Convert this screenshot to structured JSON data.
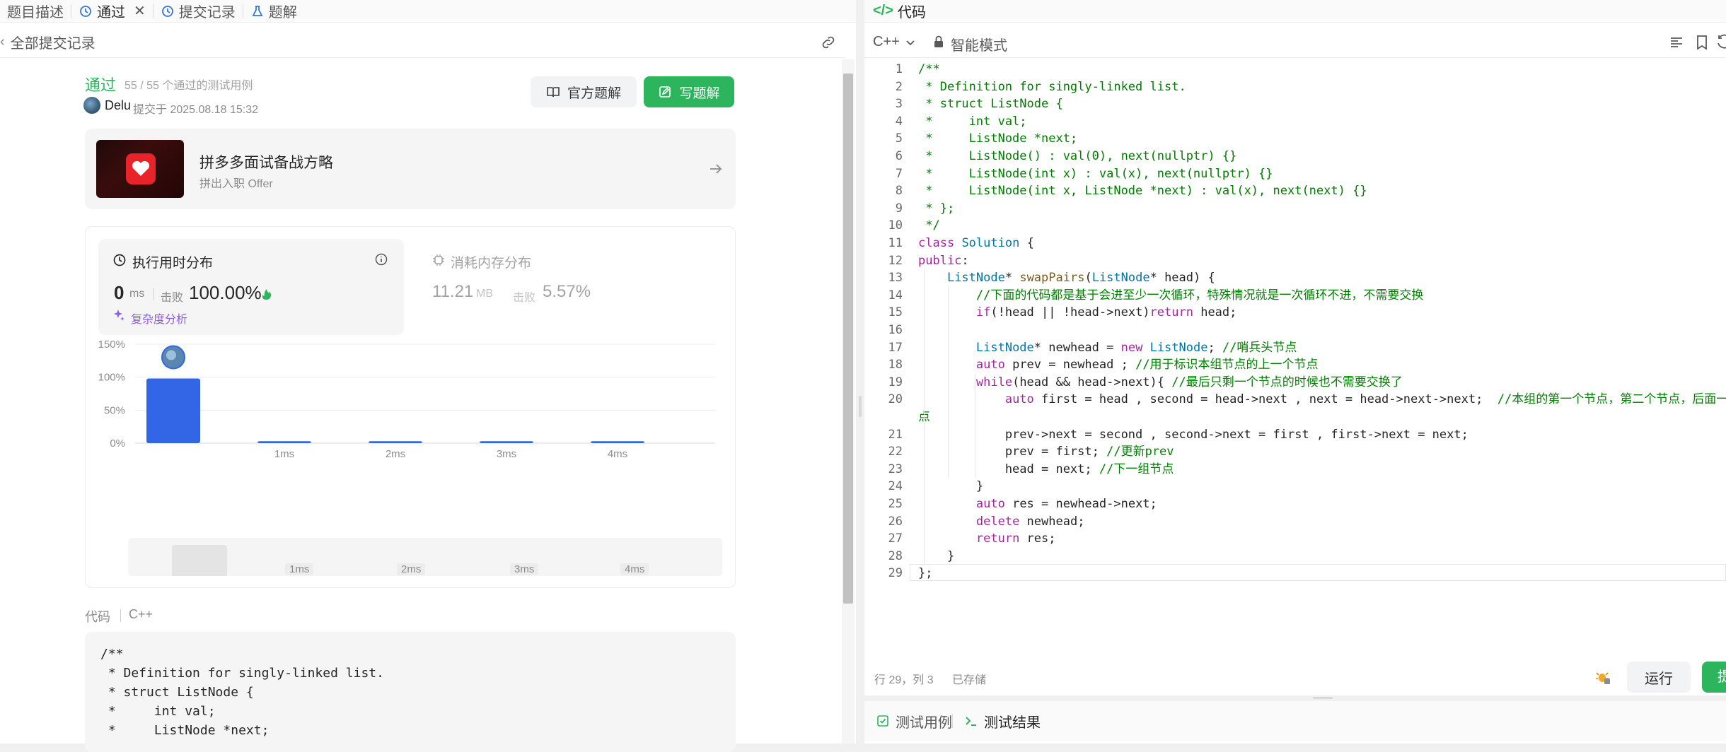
{
  "left_tabs": [
    {
      "label": "题目描述",
      "icon": "document-icon"
    },
    {
      "label": "通过",
      "icon": "history-icon",
      "closable": true
    },
    {
      "label": "提交记录",
      "icon": "history-icon"
    },
    {
      "label": "题解",
      "icon": "flask-icon"
    }
  ],
  "sub_bar": {
    "back_label": "全部提交记录"
  },
  "result": {
    "status": "通过",
    "tests": "55 / 55 个通过的测试用例",
    "user": "Delu",
    "submitted": "提交于 2025.08.18 15:32",
    "official_label": "官方题解",
    "write_label": "写题解"
  },
  "promo": {
    "title": "拼多多面试备战方略",
    "subtitle": "拼出入职 Offer"
  },
  "stats": {
    "time_title": "执行用时分布",
    "time_value": "0",
    "time_unit": "ms",
    "beat_label": "击败",
    "time_beat": "100.00%",
    "complexity_label": "复杂度分析",
    "mem_title": "消耗内存分布",
    "mem_value": "11.21",
    "mem_unit": "MB",
    "mem_beat": "5.57%"
  },
  "chart_data": {
    "type": "bar",
    "categories": [
      "0ms",
      "1ms",
      "2ms",
      "3ms",
      "4ms"
    ],
    "values": [
      98,
      3,
      3,
      3,
      3
    ],
    "x_tick_labels": [
      "",
      "1ms",
      "2ms",
      "3ms",
      "4ms"
    ],
    "y_ticks": [
      "0%",
      "50%",
      "100%",
      "150%"
    ],
    "ylim": [
      0,
      150
    ],
    "highlight_category": "0ms",
    "bar_color": "#3366e6",
    "grid": true
  },
  "mini_labels": [
    "1ms",
    "2ms",
    "3ms",
    "4ms"
  ],
  "code_section": {
    "label": "代码",
    "lang": "C++",
    "preview": [
      "/**",
      " * Definition for singly-linked list.",
      " * struct ListNode {",
      " *     int val;",
      " *     ListNode *next;"
    ]
  },
  "right_tab": {
    "label": "代码"
  },
  "toolbar": {
    "lang": "C++",
    "mode": "智能模式"
  },
  "editor": {
    "lines": [
      "/**",
      " * Definition for singly-linked list.",
      " * struct ListNode {",
      " *     int val;",
      " *     ListNode *next;",
      " *     ListNode() : val(0), next(nullptr) {}",
      " *     ListNode(int x) : val(x), next(nullptr) {}",
      " *     ListNode(int x, ListNode *next) : val(x), next(next) {}",
      " * };",
      " */",
      "class Solution {",
      "public:",
      "    ListNode* swapPairs(ListNode* head) {",
      "        //下面的代码都是基于会进至少一次循环，特殊情况就是一次循环不进，不需要交换",
      "        if(!head || !head->next)return head;",
      "",
      "        ListNode* newhead = new ListNode; //哨兵头节点",
      "        auto prev = newhead ; //用于标识本组节点的上一个节点",
      "        while(head && head->next){ //最后只剩一个节点的时候也不需要交换了",
      "            auto first = head , second = head->next , next = head->next->next;  //本组的第一个节点，第二个节点，后面一个节",
      "            prev->next = second , second->next = first , first->next = next;",
      "            prev = first; //更新prev",
      "            head = next; //下一组节点",
      "        }",
      "        auto res = newhead->next;",
      "        delete newhead;",
      "        return res;",
      "    }",
      "};"
    ],
    "wrap_continuation": "点"
  },
  "status_bar": {
    "position": "行 29，列 3",
    "saved": "已存储",
    "run_label": "运行",
    "submit_label": "提交"
  },
  "bottom_tabs": [
    {
      "label": "测试用例",
      "icon": "checkbox-icon"
    },
    {
      "label": "测试结果",
      "icon": "terminal-icon"
    }
  ]
}
